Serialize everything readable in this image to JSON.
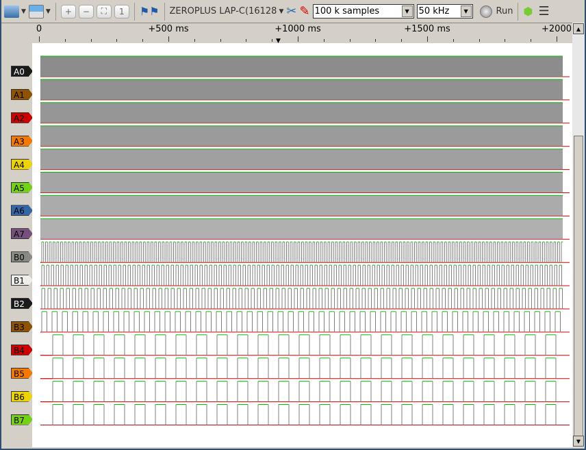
{
  "toolbar": {
    "device": "ZEROPLUS LAP-C(16128",
    "samples": "100 k samples",
    "samplerate": "50 kHz",
    "run_label": "Run"
  },
  "ruler": {
    "ticks": [
      "0",
      "+500 ms",
      "+1000 ms",
      "+1500 ms",
      "+2000"
    ]
  },
  "channels": [
    {
      "name": "A0",
      "color": "#1a1a1a",
      "text": "#fff"
    },
    {
      "name": "A1",
      "color": "#8f5202",
      "text": "#000"
    },
    {
      "name": "A2",
      "color": "#cc0000",
      "text": "#000"
    },
    {
      "name": "A3",
      "color": "#f57900",
      "text": "#000"
    },
    {
      "name": "A4",
      "color": "#edd400",
      "text": "#000"
    },
    {
      "name": "A5",
      "color": "#73d216",
      "text": "#000"
    },
    {
      "name": "A6",
      "color": "#3465a4",
      "text": "#000"
    },
    {
      "name": "A7",
      "color": "#75507b",
      "text": "#000"
    },
    {
      "name": "B0",
      "color": "#888a85",
      "text": "#000"
    },
    {
      "name": "B1",
      "color": "#eeeeec",
      "text": "#000"
    },
    {
      "name": "B2",
      "color": "#1a1a1a",
      "text": "#fff"
    },
    {
      "name": "B3",
      "color": "#8f5202",
      "text": "#000"
    },
    {
      "name": "B4",
      "color": "#cc0000",
      "text": "#000"
    },
    {
      "name": "B5",
      "color": "#f57900",
      "text": "#000"
    },
    {
      "name": "B6",
      "color": "#edd400",
      "text": "#000"
    },
    {
      "name": "B7",
      "color": "#73d216",
      "text": "#000"
    }
  ],
  "colors": {
    "high": "#00c000",
    "low": "#cc0000",
    "edge": "#7f7f7f"
  }
}
